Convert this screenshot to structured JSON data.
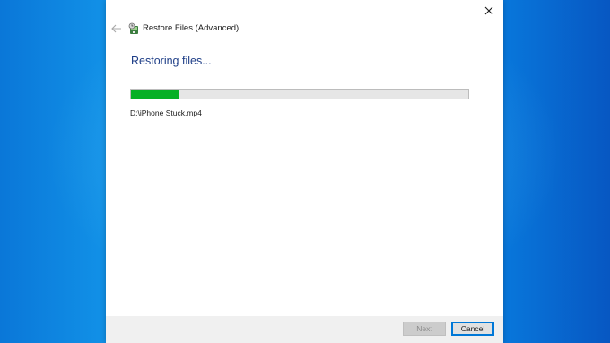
{
  "window": {
    "title": "Restore Files (Advanced)",
    "icons": {
      "back": "back-arrow-icon",
      "app": "restore-files-icon",
      "close": "close-icon"
    }
  },
  "main": {
    "heading": "Restoring files...",
    "progress": {
      "fraction": 0.14,
      "color": "#06b025"
    },
    "current_file": "D:\\iPhone Stuck.mp4"
  },
  "footer": {
    "next_label": "Next",
    "next_enabled": false,
    "cancel_label": "Cancel"
  },
  "colors": {
    "heading": "#1e3e87",
    "accent": "#0078d7"
  }
}
